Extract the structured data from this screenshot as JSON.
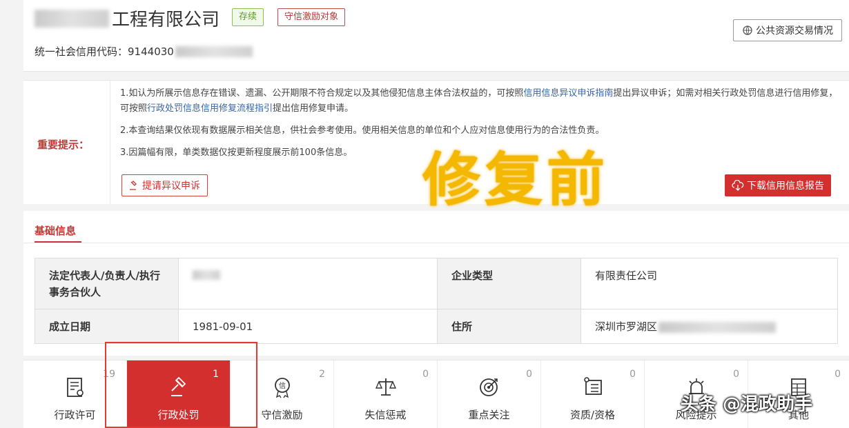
{
  "header": {
    "company_suffix": "工程有限公司",
    "status_badge": "存续",
    "incentive_badge": "守信激励对象",
    "credit_code_label": "统一社会信用代码：",
    "credit_code_value": "9144030",
    "public_resource_button": "公共资源交易情况"
  },
  "notice": {
    "label": "重要提示：",
    "line1_a": "1.如认为所展示信息存在错误、遗漏、公开期限不符合规定以及其他侵犯信息主体合法权益的，可按照",
    "line1_link1": "信用信息异议申诉指南",
    "line1_b": "提出异议申诉；如需对相关行政处罚信息进行信用修复，可按照",
    "line1_link2": "行政处罚信息信用修复流程指引",
    "line1_c": "提出信用修复申请。",
    "line2": "2.本查询结果仅依现有数据展示相关信息，供社会参考使用。使用相关信息的单位和个人应对信息使用行为的合法性负责。",
    "line3": "3.因篇幅有限，单类数据仅按更新程度展示前100条信息。",
    "appeal_button": "提请异议申诉",
    "download_button": "下载信用信息报告",
    "watermark": "修复前"
  },
  "basic": {
    "title": "基础信息",
    "rep_label": "法定代表人/负责人/执行事务合伙人",
    "type_label": "企业类型",
    "type_value": "有限责任公司",
    "date_label": "成立日期",
    "date_value": "1981-09-01",
    "addr_label": "住所",
    "addr_value": "深圳市罗湖区"
  },
  "tabs": [
    {
      "label": "行政许可",
      "count": "19",
      "icon": "license-icon"
    },
    {
      "label": "行政处罚",
      "count": "1",
      "icon": "gavel-icon"
    },
    {
      "label": "守信激励",
      "count": "2",
      "icon": "credit-medal-icon"
    },
    {
      "label": "失信惩戒",
      "count": "0",
      "icon": "scales-icon"
    },
    {
      "label": "重点关注",
      "count": "0",
      "icon": "target-icon"
    },
    {
      "label": "资质/资格",
      "count": "0",
      "icon": "certificate-icon"
    },
    {
      "label": "风险提示",
      "count": "0",
      "icon": "alarm-icon"
    },
    {
      "label": "其他",
      "count": "0",
      "icon": "table-icon"
    }
  ],
  "overlay": {
    "toutiao": "头条 @混政助手"
  },
  "colors": {
    "accent_red": "#d32f2f",
    "status_green": "#5c9b2d",
    "link_blue": "#3a64a8",
    "watermark_gold": "#f5b800"
  }
}
